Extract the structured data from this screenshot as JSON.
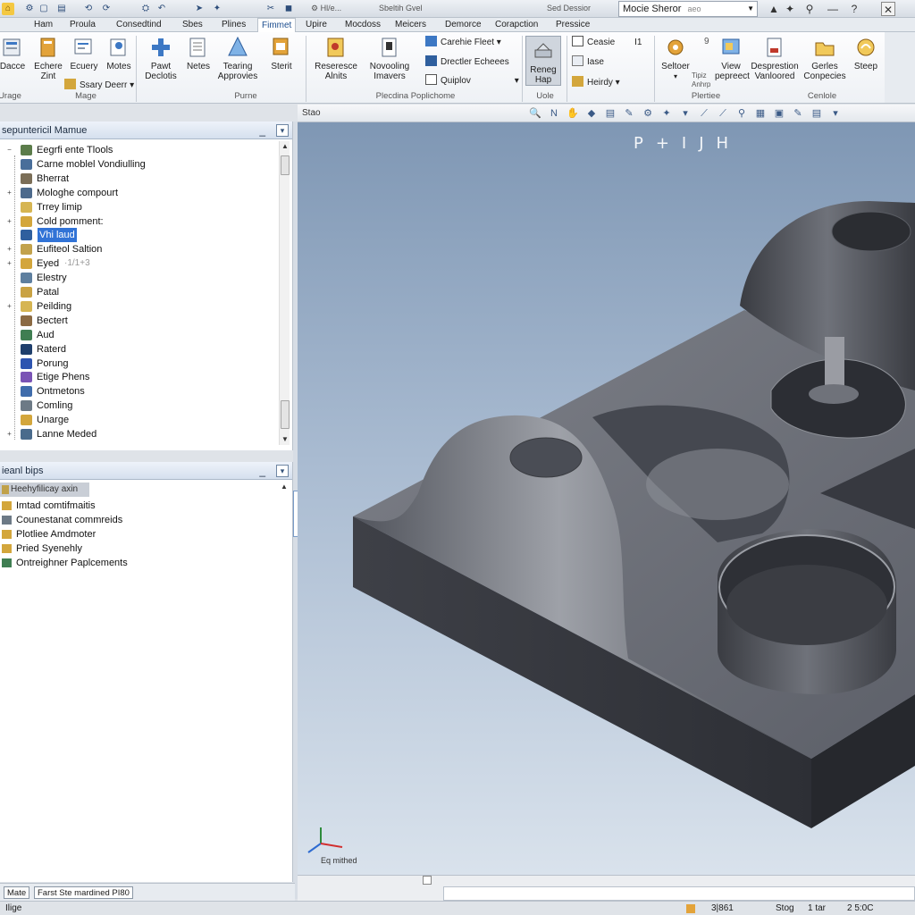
{
  "titlebar": {
    "quick_access": [
      "⚙",
      "📄",
      "🖫",
      "⟲",
      "⟳",
      "✎",
      "⛭",
      "⟲",
      "✂",
      "⚙"
    ],
    "qa_text1": "⚙ Hl/e...",
    "qa_text2": "Sbeltih Gvel",
    "qa_text3": "Sed Dessior",
    "doc_title": "Mocie Sheror",
    "doc_sub": "aeo",
    "window_buttons": [
      "▲",
      "✦",
      "—",
      "☐",
      "✕"
    ]
  },
  "tabs": [
    "Ham",
    "Proula",
    "Consedtind",
    "Sbes",
    "Plines",
    "Fimmet",
    "Upire",
    "Mocdoss",
    "Meicers",
    "Demorce",
    "Corapction",
    "Pressice"
  ],
  "active_tab": "Fimmet",
  "ribbon": {
    "big": [
      {
        "label": "Dacce",
        "label2": ""
      },
      {
        "label": "Echere",
        "label2": "Zint"
      },
      {
        "label": "Ecuery",
        "label2": ""
      },
      {
        "label": "Motes",
        "label2": ""
      },
      {
        "label": "Pawt",
        "label2": "Declotis"
      },
      {
        "label": "Netes",
        "label2": ""
      },
      {
        "label": "Tearing",
        "label2": "Approvies"
      },
      {
        "label": "Sterit",
        "label2": ""
      },
      {
        "label": "Reseresce",
        "label2": "Alnits"
      },
      {
        "label": "Novooling",
        "label2": "Imavers"
      },
      {
        "label": "Reneg",
        "label2": "Hap"
      },
      {
        "label": "Seltoer",
        "label2": ""
      },
      {
        "label": "View",
        "label2": "pepreect"
      },
      {
        "label": "Desprestion",
        "label2": "Vanloored"
      },
      {
        "label": "Gerles",
        "label2": "Conpecies"
      },
      {
        "label": "Steep",
        "label2": ""
      }
    ],
    "small": {
      "ssary": "Ssary Deerr",
      "carble": "Carehie Fleet",
      "drectler": "Drectler Echeees",
      "quiplov": "Quiplov",
      "ceasie": "Ceasie",
      "ceasie_num": "I1",
      "iase": "Iase",
      "heirdy": "Heirdy",
      "hbiz": "Tipiz",
      "hbiz2": "Anhrp",
      "badge9": "9"
    },
    "groups": [
      "Urage",
      "Mage",
      "Purne",
      "Plecdina Poplichome",
      "Uole",
      "Plertiee",
      "Cenlole"
    ]
  },
  "panel1": {
    "title": "sepuntericil Mamue",
    "rows": [
      {
        "label": "Eegrfi ente Tlools",
        "expander": "−",
        "color": "#5b7c4a",
        "indent": 0,
        "dim": ""
      },
      {
        "label": "Carne moblel Vondiulling",
        "expander": "",
        "color": "#496e9a",
        "indent": 1,
        "dim": ""
      },
      {
        "label": "Bherrat",
        "expander": "",
        "color": "#7b6e57",
        "indent": 1,
        "dim": ""
      },
      {
        "label": "Mologhe compourt",
        "expander": "+",
        "color": "#4d6a8c",
        "indent": 1,
        "dim": ""
      },
      {
        "label": "Trrey limip",
        "expander": "",
        "color": "#d6b552",
        "indent": 1,
        "dim": ""
      },
      {
        "label": "Cold pomment:",
        "expander": "+",
        "color": "#d3a63c",
        "indent": 1,
        "dim": ""
      },
      {
        "label": "Vhi laud",
        "expander": "",
        "color": "#2f5f9e",
        "indent": 1,
        "dim": "",
        "selected": true
      },
      {
        "label": "Eufiteol Saltion",
        "expander": "+",
        "color": "#c2a24c",
        "indent": 1,
        "dim": ""
      },
      {
        "label": "Eyed",
        "expander": "+",
        "color": "#d3a63c",
        "indent": 1,
        "dim": "·1/1+3"
      },
      {
        "label": "Elestry",
        "expander": "",
        "color": "#5e7f9f",
        "indent": 1,
        "dim": ""
      },
      {
        "label": "Patal",
        "expander": "",
        "color": "#c9a243",
        "indent": 1,
        "dim": ""
      },
      {
        "label": "Peilding",
        "expander": "+",
        "color": "#d6b552",
        "indent": 1,
        "dim": ""
      },
      {
        "label": "Bectert",
        "expander": "",
        "color": "#8b6a43",
        "indent": 1,
        "dim": ""
      },
      {
        "label": "Aud",
        "expander": "",
        "color": "#3f7e52",
        "indent": 1,
        "dim": ""
      },
      {
        "label": "Raterd",
        "expander": "",
        "color": "#1f3f6c",
        "indent": 1,
        "dim": ""
      },
      {
        "label": "Porung",
        "expander": "",
        "color": "#2d54b0",
        "indent": 1,
        "dim": ""
      },
      {
        "label": "Etige Phens",
        "expander": "",
        "color": "#7a53b5",
        "indent": 1,
        "dim": ""
      },
      {
        "label": "Ontmetons",
        "expander": "",
        "color": "#3f6cab",
        "indent": 1,
        "dim": ""
      },
      {
        "label": "Comling",
        "expander": "",
        "color": "#6d7a86",
        "indent": 1,
        "dim": ""
      },
      {
        "label": "Unarge",
        "expander": "",
        "color": "#d3a63c",
        "indent": 1,
        "dim": ""
      },
      {
        "label": "Lanne Meded",
        "expander": "+",
        "color": "#4a6b8c",
        "indent": 1,
        "dim": ""
      }
    ]
  },
  "panel2": {
    "title": "ieanl bips",
    "header_row": "Heehyfilicay axin",
    "rows": [
      "Imtad comtifmaitis",
      "Counestanat commreids",
      "Plotliee Amdmoter",
      "Pried Syenehly",
      "Ontreighner Paplcements"
    ],
    "row_colors": [
      "#d3a63c",
      "#6d7a86",
      "#d3a63c",
      "#d3a63c",
      "#3f7e52"
    ]
  },
  "bottom_tabs": [
    "Mate",
    "Farst Ste mardined PI80"
  ],
  "viewport": {
    "toolbar_label": "Stao",
    "viewcube": "P+IJH",
    "axis_label": "Eq mithed",
    "background_top": "#7f97b4",
    "background_bottom": "#d9e2ec"
  },
  "status": {
    "left": "Ilige",
    "coord1": "3|861",
    "coord2": "Stog",
    "coord3": "1 tar",
    "coord4": "2 5:0C"
  },
  "colors": {
    "accent": "#3173d6",
    "ribbon_active": "#1d4e8f"
  }
}
